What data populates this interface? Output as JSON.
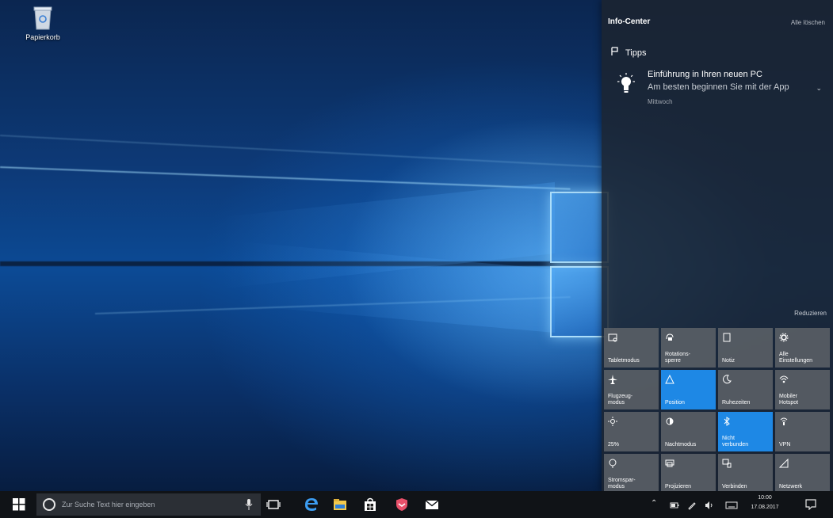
{
  "desktop": {
    "recycle_bin_label": "Papierkorb"
  },
  "action_center": {
    "title": "Info-Center",
    "clear_all": "Alle löschen",
    "group_name": "Tipps",
    "notification": {
      "title": "Einführung in Ihren neuen PC",
      "body": "Am besten beginnen Sie mit der App",
      "time": "Mittwoch"
    },
    "collapse_label": "Reduzieren",
    "quick_actions": [
      {
        "label": "Tabletmodus",
        "icon": "tablet-icon",
        "active": false
      },
      {
        "label": "Rotations-\nsperre",
        "icon": "rotation-lock-icon",
        "active": false
      },
      {
        "label": "Notiz",
        "icon": "note-icon",
        "active": false
      },
      {
        "label": "Alle\nEinstellungen",
        "icon": "gear-icon",
        "active": false
      },
      {
        "label": "Flugzeug-\nmodus",
        "icon": "airplane-icon",
        "active": false
      },
      {
        "label": "Position",
        "icon": "location-icon",
        "active": true
      },
      {
        "label": "Ruhezeiten",
        "icon": "moon-icon",
        "active": false
      },
      {
        "label": "Mobiler\nHotspot",
        "icon": "hotspot-icon",
        "active": false
      },
      {
        "label": "25%",
        "icon": "brightness-icon",
        "active": false
      },
      {
        "label": "Nachtmodus",
        "icon": "night-light-icon",
        "active": false
      },
      {
        "label": "Nicht\nverbunden",
        "icon": "bluetooth-icon",
        "active": true
      },
      {
        "label": "VPN",
        "icon": "vpn-icon",
        "active": false
      },
      {
        "label": "Stromspar-\nmodus",
        "icon": "battery-saver-icon",
        "active": false
      },
      {
        "label": "Projizieren",
        "icon": "project-icon",
        "active": false
      },
      {
        "label": "Verbinden",
        "icon": "connect-icon",
        "active": false
      },
      {
        "label": "Netzwerk",
        "icon": "network-icon",
        "active": false
      }
    ]
  },
  "taskbar": {
    "search_placeholder": "Zur Suche Text hier eingeben",
    "clock_time": "10:00",
    "clock_date": "17.08.2017"
  },
  "colors": {
    "accent": "#1e88e5",
    "tile": "#5a5f66",
    "taskbar": "#101317"
  }
}
